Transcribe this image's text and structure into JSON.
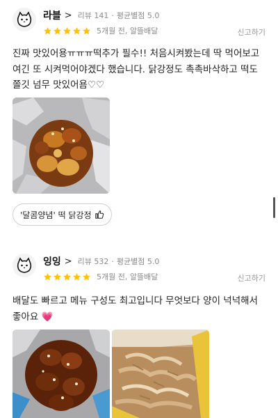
{
  "reviews": [
    {
      "nickname": "라블",
      "chevron": ">",
      "review_count": "리뷰 141",
      "average_rating": "평균별점 5.0",
      "stars": 5,
      "date_info": "5개월 전, 알뜰배달",
      "report_label": "신고하기",
      "text": "진짜 맛있어용ㅠㅠㅠ떡추가 필수!! 처음시켜봤는데 딱 먹어보고 여긴 또 시켜먹어야겠다 했습니다. 닭강정도 촉촉바삭하고 떡도 쫄깃 넘무 맛있어욤♡♡",
      "tag_label": "'달콤양념' 떡 닭강정",
      "photo_icons": [
        "chicken-foil-photo"
      ]
    },
    {
      "nickname": "잉잉",
      "chevron": ">",
      "review_count": "리뷰 532",
      "average_rating": "평균별점 5.0",
      "stars": 5,
      "date_info": "5개월 전, 알뜰배달",
      "report_label": "신고하기",
      "text": "배달도 빠르고 메뉴 구성도 최고입니다 무엇보다 양이 넉넉해서 좋아요 💗",
      "photo_icons": [
        "chicken-box-photo",
        "bonito-flakes-photo"
      ]
    }
  ],
  "colors": {
    "star": "#ffc107",
    "meta_gray": "#8a8a8a",
    "text": "#222222"
  }
}
